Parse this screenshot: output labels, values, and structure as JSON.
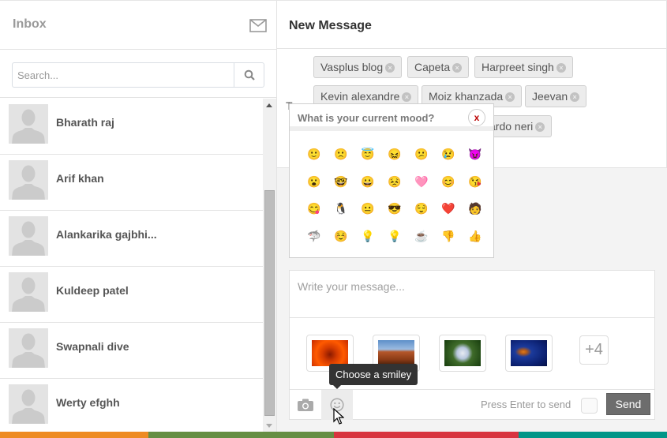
{
  "inbox": {
    "title": "Inbox",
    "search_placeholder": "Search...",
    "contacts": [
      {
        "name": "Bharath raj"
      },
      {
        "name": "Arif khan"
      },
      {
        "name": "Alankarika gajbhi..."
      },
      {
        "name": "Kuldeep patel"
      },
      {
        "name": "Swapnali dive"
      },
      {
        "name": "Werty efghh"
      }
    ]
  },
  "compose": {
    "title": "New Message",
    "to_label": "T",
    "recipients": [
      {
        "name": "Vasplus blog"
      },
      {
        "name": "Capeta"
      },
      {
        "name": "Harpreet singh"
      },
      {
        "name": "Kevin alexandre"
      },
      {
        "name": "Moiz khanzada"
      },
      {
        "name": "Jeevan"
      },
      {
        "name": "ardo neri"
      }
    ],
    "message_placeholder": "Write your message...",
    "attachments": [
      "flower-red",
      "desert-mesa",
      "flower-white",
      "jellyfish"
    ],
    "more_attachments": "+4",
    "press_enter_label": "Press Enter to send",
    "send_label": "Send",
    "tooltip": "Choose a smiley"
  },
  "mood_popup": {
    "title": "What is your current mood?",
    "close_label": "x",
    "emoticons": [
      {
        "name": "smile",
        "glyph": "🙂"
      },
      {
        "name": "frown",
        "glyph": "🙁"
      },
      {
        "name": "angel",
        "glyph": "😇"
      },
      {
        "name": "squint",
        "glyph": "😖"
      },
      {
        "name": "confused",
        "glyph": "😕"
      },
      {
        "name": "cry",
        "glyph": "😢"
      },
      {
        "name": "devil",
        "glyph": "😈"
      },
      {
        "name": "gasp",
        "glyph": "😮"
      },
      {
        "name": "glasses",
        "glyph": "🤓"
      },
      {
        "name": "grin",
        "glyph": "😀"
      },
      {
        "name": "upset",
        "glyph": "😣"
      },
      {
        "name": "heart",
        "glyph": "🩷"
      },
      {
        "name": "kiki",
        "glyph": "😊"
      },
      {
        "name": "kiss",
        "glyph": "😘"
      },
      {
        "name": "pacman",
        "glyph": "😋"
      },
      {
        "name": "penguin",
        "glyph": "🐧"
      },
      {
        "name": "unsure",
        "glyph": "😐"
      },
      {
        "name": "sunglasses",
        "glyph": "😎"
      },
      {
        "name": "squint-smile",
        "glyph": "😌"
      },
      {
        "name": "red-heart",
        "glyph": "❤️"
      },
      {
        "name": "putnam",
        "glyph": "🧑"
      },
      {
        "name": "shark",
        "glyph": "🦈"
      },
      {
        "name": "colonthree",
        "glyph": "☺️"
      },
      {
        "name": "bulb-off",
        "glyph": "💡"
      },
      {
        "name": "bulb-on",
        "glyph": "💡"
      },
      {
        "name": "coffee",
        "glyph": "☕"
      },
      {
        "name": "thumbs-down",
        "glyph": "👎"
      },
      {
        "name": "thumbs-up",
        "glyph": "👍"
      }
    ]
  },
  "colors": {
    "strip": [
      "#ee8b23",
      "#658e43",
      "#d8343f",
      "#009688"
    ],
    "send_bg": "#6d6d6d"
  }
}
